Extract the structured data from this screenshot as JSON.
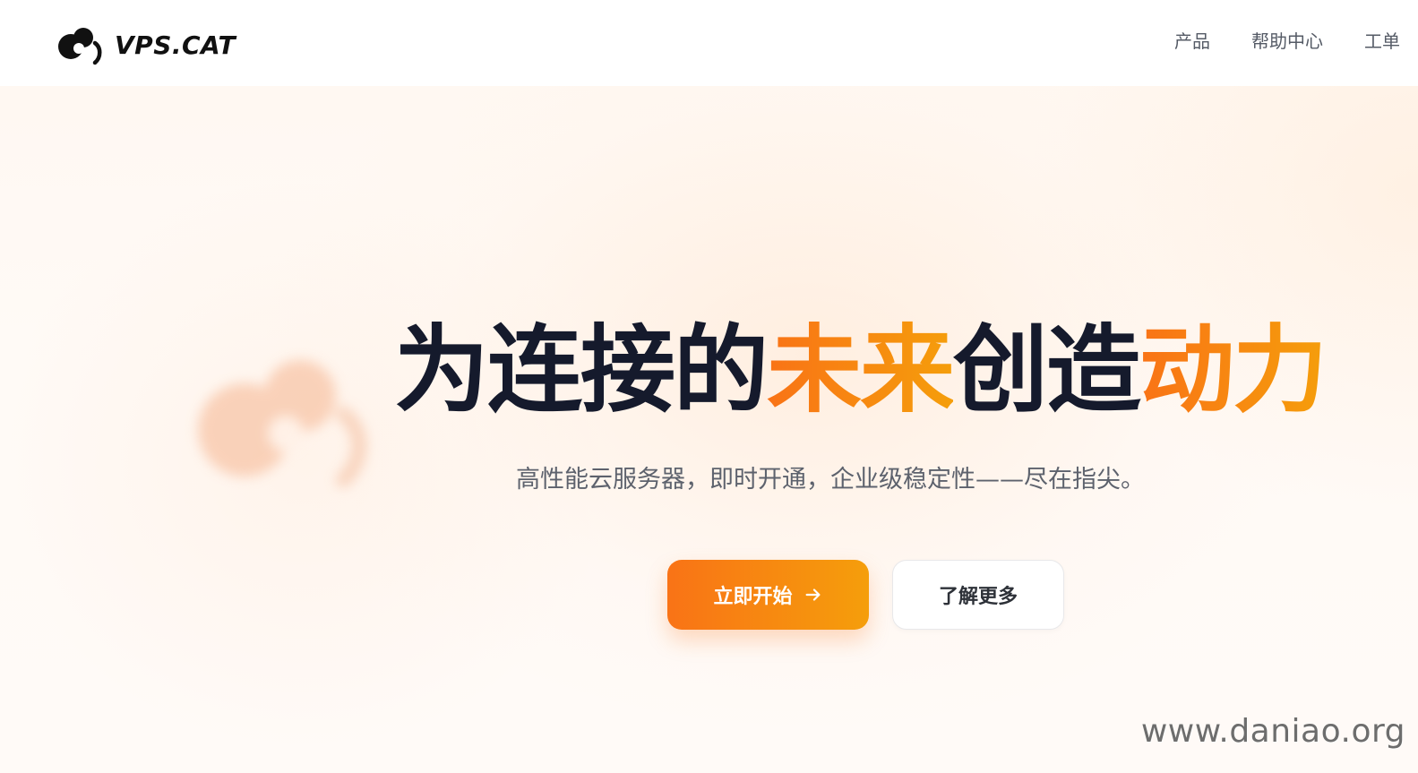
{
  "header": {
    "logo_text": "VPS.CAT",
    "logo_icon": "cat-cloud-logo-icon",
    "nav": [
      {
        "label": "产品"
      },
      {
        "label": "帮助中心"
      },
      {
        "label": "工单"
      }
    ]
  },
  "hero": {
    "headline": {
      "part1": "为连接的",
      "part2": "未来",
      "part3": "创造",
      "part4": "动力"
    },
    "subtitle": "高性能云服务器，即时开通，企业级稳定性——尽在指尖。",
    "primary_button": "立即开始",
    "primary_button_icon": "arrow-right-icon",
    "secondary_button": "了解更多"
  },
  "watermark": "www.daniao.org",
  "colors": {
    "accent_start": "#f97316",
    "accent_end": "#f59e0b",
    "headline_dark": "#151a2c",
    "subtitle_gray": "#5d626d",
    "nav_gray": "#555b66"
  }
}
